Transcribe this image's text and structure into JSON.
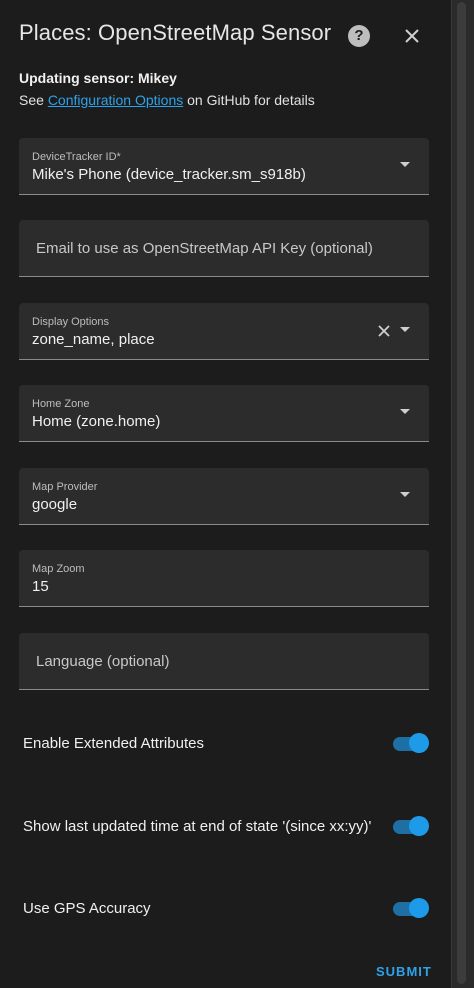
{
  "dialog": {
    "title": "Places: OpenStreetMap Sensor",
    "help_icon": "help-circle-icon",
    "close_icon": "close-icon",
    "updating_text": "Updating sensor: Mikey",
    "see_prefix": "See ",
    "config_link": "Configuration Options",
    "see_suffix": " on GitHub for details"
  },
  "fields": {
    "device_tracker": {
      "label": "DeviceTracker ID*",
      "value": "Mike's Phone (device_tracker.sm_s918b)"
    },
    "email": {
      "placeholder": "Email to use as OpenStreetMap API Key (optional)"
    },
    "display_options": {
      "label": "Display Options",
      "value": "zone_name, place"
    },
    "home_zone": {
      "label": "Home Zone",
      "value": "Home (zone.home)"
    },
    "map_provider": {
      "label": "Map Provider",
      "value": "google"
    },
    "map_zoom": {
      "label": "Map Zoom",
      "value": "15"
    },
    "language": {
      "placeholder": "Language (optional)"
    }
  },
  "toggles": {
    "extended_attributes": {
      "label": "Enable Extended Attributes",
      "on": true
    },
    "last_updated": {
      "label": "Show last updated time at end of state '(since xx:yy)'",
      "on": true
    },
    "gps_accuracy": {
      "label": "Use GPS Accuracy",
      "on": true
    }
  },
  "actions": {
    "submit": "SUBMIT"
  },
  "colors": {
    "accent": "#1e9be8",
    "link": "#2ea2e8",
    "background": "#1c1c1c",
    "field_bg": "#2c2c2c"
  }
}
